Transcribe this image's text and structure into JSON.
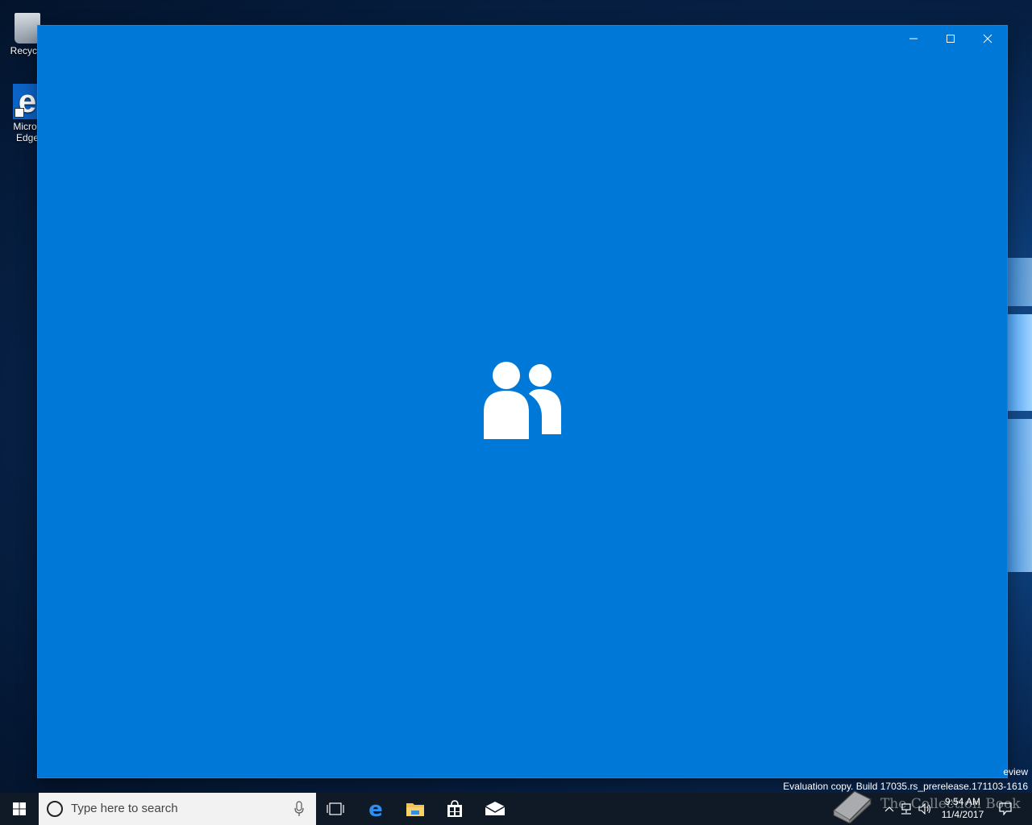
{
  "desktop": {
    "icons": [
      {
        "label": "Recycle",
        "icon": "recycle-bin-icon"
      },
      {
        "label": "Micros\nEdge",
        "icon": "edge-icon"
      }
    ]
  },
  "app_window": {
    "background_color": "#0078d7",
    "splash_icon": "people-icon",
    "controls": {
      "minimize": "minimize-icon",
      "maximize": "maximize-icon",
      "close": "close-icon"
    }
  },
  "watermark": {
    "edition": "eview",
    "build": "Evaluation copy. Build 17035.rs_prerelease.171103-1616"
  },
  "taskbar": {
    "search_placeholder": "Type here to search",
    "pinned": [
      {
        "name": "task-view",
        "icon": "task-view-icon"
      },
      {
        "name": "edge",
        "icon": "edge-icon"
      },
      {
        "name": "file-explorer",
        "icon": "folder-icon"
      },
      {
        "name": "store",
        "icon": "store-icon"
      },
      {
        "name": "mail",
        "icon": "mail-icon"
      }
    ],
    "overlay_text": "The Collection Book",
    "clock_time": "9:54 AM",
    "clock_date": "11/4/2017"
  }
}
